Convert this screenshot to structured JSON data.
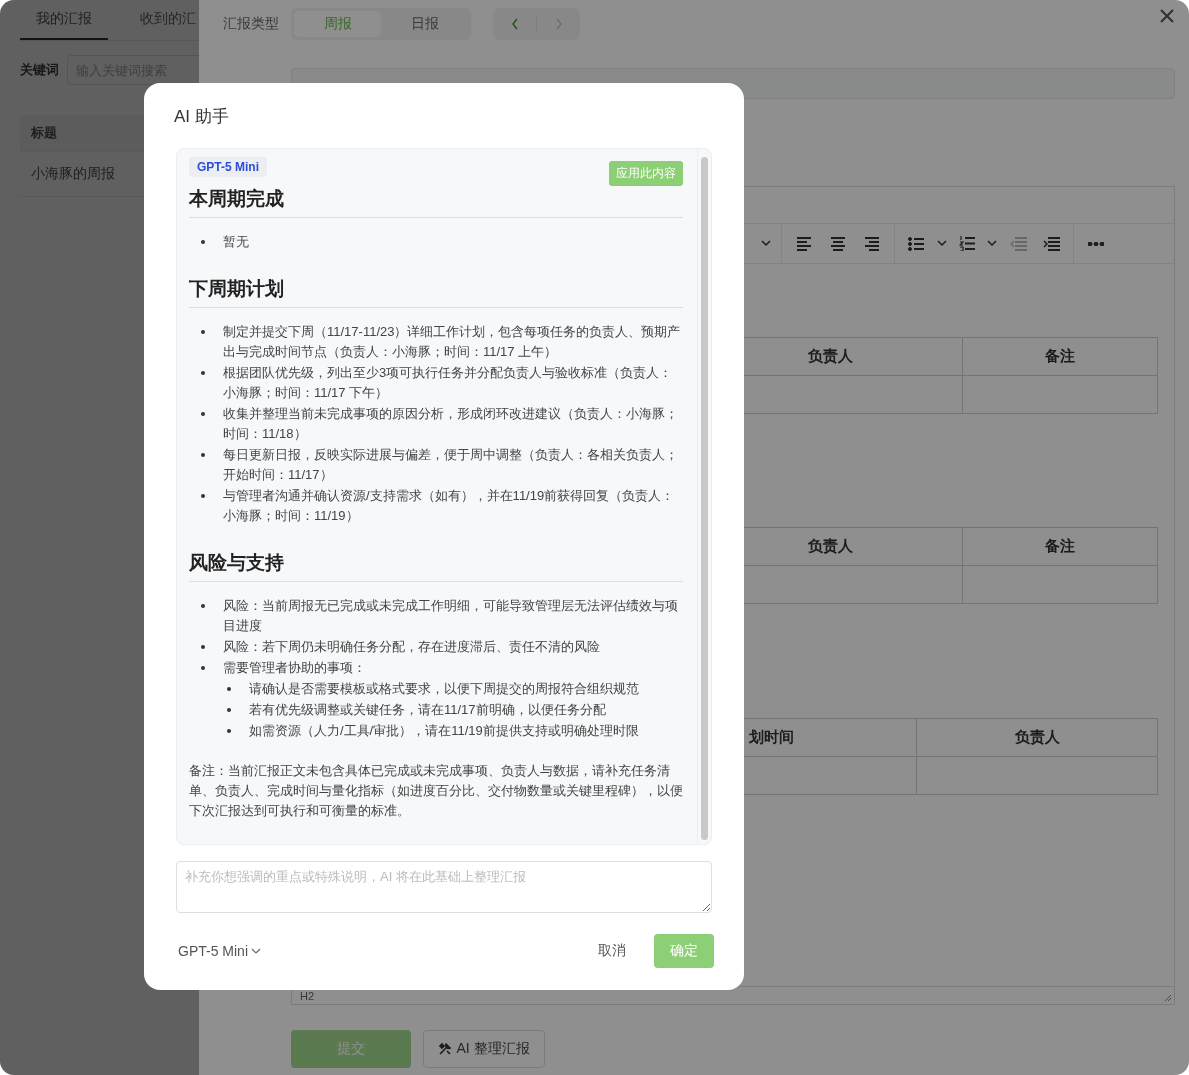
{
  "left_panel": {
    "tabs": [
      {
        "label": "我的汇报",
        "selected": true
      },
      {
        "label": "收到的汇",
        "selected": false
      }
    ],
    "search": {
      "label": "关键词",
      "placeholder": "输入关键词搜索"
    },
    "table": {
      "columns": [
        "标题"
      ],
      "rows": [
        "小海豚的周报"
      ]
    }
  },
  "drawer": {
    "type_label": "汇报类型",
    "type_options": [
      {
        "label": "周报",
        "selected": true
      },
      {
        "label": "日报",
        "selected": false
      }
    ],
    "pager": [
      {
        "kind": "prev",
        "disabled": false
      },
      {
        "kind": "next",
        "disabled": true
      }
    ],
    "editor": {
      "toolbar_groups": [
        {
          "items": [
            {
              "kind": "caret",
              "disabled": false
            }
          ]
        },
        {
          "items": [
            {
              "kind": "align-left",
              "disabled": false
            },
            {
              "kind": "align-center",
              "disabled": false
            },
            {
              "kind": "align-right",
              "disabled": false
            }
          ]
        },
        {
          "items": [
            {
              "kind": "bullet-list",
              "disabled": false
            },
            {
              "kind": "caret",
              "disabled": false
            },
            {
              "kind": "numbered-list",
              "disabled": false
            },
            {
              "kind": "caret",
              "disabled": false
            },
            {
              "kind": "outdent",
              "disabled": true
            },
            {
              "kind": "indent",
              "disabled": false
            }
          ]
        },
        {
          "items": [
            {
              "kind": "more",
              "disabled": false
            }
          ]
        }
      ],
      "tables": [
        {
          "columns": [
            "负责人",
            "备注"
          ]
        },
        {
          "columns": [
            "负责人",
            "备注"
          ]
        },
        {
          "columns": [
            "划时间",
            "负责人"
          ]
        }
      ],
      "status": "H2"
    },
    "buttons": [
      {
        "kind": "primary",
        "label": "提交"
      },
      {
        "kind": "ai",
        "label": "AI 整理汇报"
      }
    ]
  },
  "dialog": {
    "title": "AI 助手",
    "model_badge": "GPT-5 Mini",
    "apply_button": "应用此内容",
    "sections": [
      {
        "heading": "本周期完成",
        "items": [
          {
            "text": "暂无"
          }
        ]
      },
      {
        "heading": "下周期计划",
        "items": [
          {
            "text": "制定并提交下周（11/17-11/23）详细工作计划，包含每项任务的负责人、预期产出与完成时间节点（负责人：小海豚；时间：11/17 上午）"
          },
          {
            "text": "根据团队优先级，列出至少3项可执行任务并分配负责人与验收标准（负责人：小海豚；时间：11/17 下午）"
          },
          {
            "text": "收集并整理当前未完成事项的原因分析，形成闭环改进建议（负责人：小海豚；时间：11/18）"
          },
          {
            "text": "每日更新日报，反映实际进展与偏差，便于周中调整（负责人：各相关负责人；开始时间：11/17）"
          },
          {
            "text": "与管理者沟通并确认资源/支持需求（如有），并在11/19前获得回复（负责人：小海豚；时间：11/19）"
          }
        ]
      },
      {
        "heading": "风险与支持",
        "items": [
          {
            "text": "风险：当前周报无已完成或未完成工作明细，可能导致管理层无法评估绩效与项目进度"
          },
          {
            "text": "风险：若下周仍未明确任务分配，存在进度滞后、责任不清的风险"
          },
          {
            "text": "需要管理者协助的事项：",
            "children": [
              {
                "text": "请确认是否需要模板或格式要求，以便下周提交的周报符合组织规范"
              },
              {
                "text": "若有优先级调整或关键任务，请在11/17前明确，以便任务分配"
              },
              {
                "text": "如需资源（人力/工具/审批），请在11/19前提供支持或明确处理时限"
              }
            ]
          }
        ]
      }
    ],
    "note": "备注：当前汇报正文未包含具体已完成或未完成事项、负责人与数据，请补充任务清单、负责人、完成时间与量化指标（如进度百分比、交付物数量或关键里程碑），以便下次汇报达到可执行和可衡量的标准。",
    "prompt": {
      "placeholder": "补充你想强调的重点或特殊说明，AI 将在此基础上整理汇报"
    },
    "model_select": "GPT-5 Mini",
    "cancel": "取消",
    "confirm": "确定"
  }
}
